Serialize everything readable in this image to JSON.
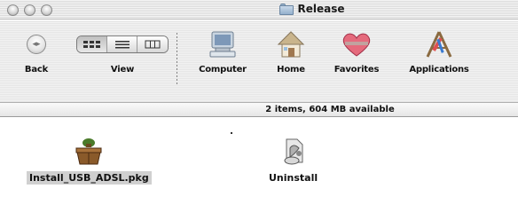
{
  "window": {
    "title": "Release"
  },
  "toolbar": {
    "back_label": "Back",
    "view_label": "View",
    "computer_label": "Computer",
    "home_label": "Home",
    "favorites_label": "Favorites",
    "applications_label": "Applications"
  },
  "status": {
    "text": "2 items, 604 MB available"
  },
  "files": [
    {
      "name": "Install_USB_ADSL.pkg",
      "icon": "package-icon",
      "selected": true
    },
    {
      "name": "Uninstall",
      "icon": "uninstaller-icon",
      "selected": false
    }
  ],
  "colors": {
    "selection": "#d0d0d0",
    "favorites_heart": "#e0405a"
  }
}
